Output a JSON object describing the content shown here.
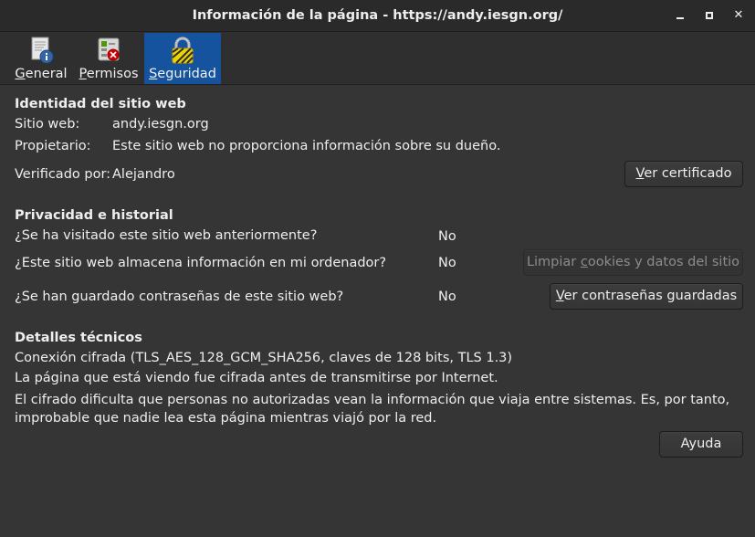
{
  "window": {
    "title": "Información de la página - https://andy.iesgn.org/",
    "minimize_label": "",
    "maximize_label": "",
    "close_label": "✕"
  },
  "tabs": [
    {
      "label_pre": "",
      "label_ul": "G",
      "label_post": "eneral",
      "icon": "document-info-icon"
    },
    {
      "label_pre": "",
      "label_ul": "P",
      "label_post": "ermisos",
      "icon": "permissions-icon"
    },
    {
      "label_pre": "",
      "label_ul": "S",
      "label_post": "eguridad",
      "icon": "padlock-icon",
      "selected": true
    }
  ],
  "identity": {
    "title": "Identidad del sitio web",
    "site_label": "Sitio web:",
    "site_value": "andy.iesgn.org",
    "owner_label": "Propietario:",
    "owner_value": "Este sitio web no proporciona información sobre su dueño.",
    "verified_label": "Verificado por:",
    "verified_value": "Alejandro",
    "cert_button_ul": "V",
    "cert_button_rest": "er certificado"
  },
  "privacy": {
    "title": "Privacidad e historial",
    "q1": "¿Se ha visitado este sitio web anteriormente?",
    "a1": "No",
    "q2": "¿Este sitio web almacena información en mi ordenador?",
    "a2": "No",
    "cookies_button_pre": "Limpiar ",
    "cookies_button_ul": "c",
    "cookies_button_post": "ookies y datos del sitio",
    "q3": "¿Se han guardado contraseñas de este sitio web?",
    "a3": "No",
    "passwords_button_ul": "V",
    "passwords_button_rest": "er contraseñas guardadas"
  },
  "technical": {
    "title": "Detalles técnicos",
    "line1": "Conexión cifrada (TLS_AES_128_GCM_SHA256, claves de 128 bits, TLS 1.3)",
    "line2": "La página que está viendo fue cifrada antes de transmitirse por Internet.",
    "line3": "El cifrado dificulta que personas no autorizadas vean la información que viaja entre sistemas. Es, por tanto, improbable que nadie lea esta página mientras viajó por la red."
  },
  "help_button": "Ayuda",
  "colors": {
    "selected_tab": "#15539e",
    "background": "#353535"
  }
}
